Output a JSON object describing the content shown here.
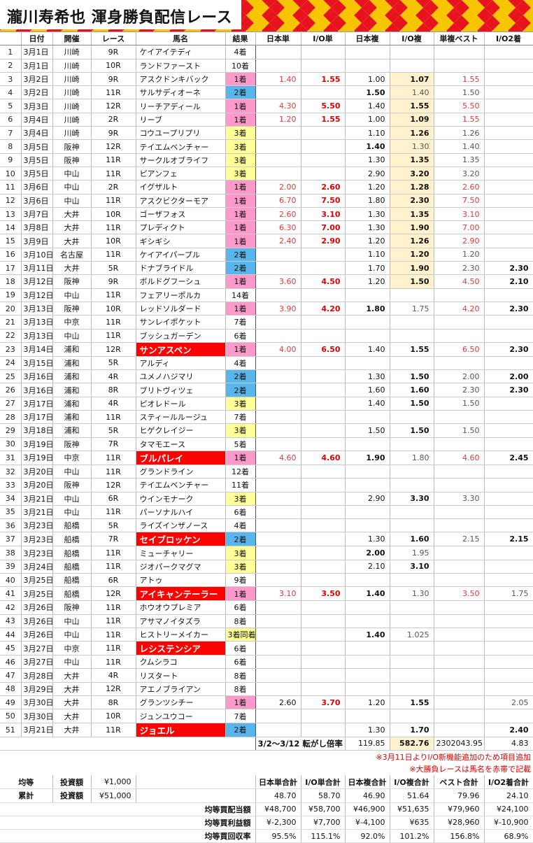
{
  "title": "瀧川寿希也 渾身勝負配信レース",
  "headers": [
    "",
    "日付",
    "開催",
    "レース",
    "馬名",
    "結果",
    "日本単",
    "I/O単",
    "日本複",
    "I/O複",
    "単複ベスト",
    "I/O2着"
  ],
  "rows": [
    [
      "1",
      "3月1日",
      "川崎",
      "9R",
      "ケイアイテディ",
      "4着",
      "",
      "",
      "",
      "",
      "",
      ""
    ],
    [
      "2",
      "3月1日",
      "川崎",
      "10R",
      "ランドファースト",
      "10着",
      "",
      "",
      "",
      "",
      "",
      ""
    ],
    [
      "3",
      "3月2日",
      "川崎",
      "9R",
      "アスクドンキバック",
      "1着",
      "1.40",
      "1.55",
      "1.00",
      "1.07",
      "1.55",
      ""
    ],
    [
      "4",
      "3月2日",
      "川崎",
      "11R",
      "サルサディオーネ",
      "2着",
      "",
      "",
      "1.50",
      "1.40",
      "1.50",
      ""
    ],
    [
      "5",
      "3月3日",
      "川崎",
      "12R",
      "リーチアディール",
      "1着",
      "4.30",
      "5.50",
      "1.40",
      "1.55",
      "5.50",
      ""
    ],
    [
      "6",
      "3月4日",
      "川崎",
      "2R",
      "リーブ",
      "1着",
      "1.20",
      "1.55",
      "1.00",
      "1.09",
      "1.55",
      ""
    ],
    [
      "7",
      "3月4日",
      "川崎",
      "9R",
      "コウユープリプリ",
      "3着",
      "",
      "",
      "1.10",
      "1.26",
      "1.26",
      ""
    ],
    [
      "8",
      "3月5日",
      "阪神",
      "12R",
      "テイエムベンチャー",
      "3着",
      "",
      "",
      "1.40",
      "1.30",
      "1.40",
      ""
    ],
    [
      "9",
      "3月5日",
      "阪神",
      "11R",
      "サークルオブライフ",
      "3着",
      "",
      "",
      "1.30",
      "1.35",
      "1.35",
      ""
    ],
    [
      "10",
      "3月5日",
      "中山",
      "11R",
      "ピアンフェ",
      "3着",
      "",
      "",
      "2.90",
      "3.20",
      "3.20",
      ""
    ],
    [
      "11",
      "3月6日",
      "中山",
      "2R",
      "イグザルト",
      "1着",
      "2.00",
      "2.60",
      "1.20",
      "1.28",
      "2.60",
      ""
    ],
    [
      "12",
      "3月6日",
      "中山",
      "11R",
      "アスクビクターモア",
      "1着",
      "6.70",
      "7.50",
      "1.80",
      "2.30",
      "7.50",
      ""
    ],
    [
      "13",
      "3月7日",
      "大井",
      "10R",
      "ゴーザフォス",
      "1着",
      "2.60",
      "3.10",
      "1.30",
      "1.35",
      "3.10",
      ""
    ],
    [
      "14",
      "3月8日",
      "大井",
      "11R",
      "プレディクト",
      "1着",
      "6.30",
      "7.00",
      "1.30",
      "1.90",
      "7.00",
      ""
    ],
    [
      "15",
      "3月9日",
      "大井",
      "10R",
      "ギシギシ",
      "1着",
      "2.40",
      "2.90",
      "1.20",
      "1.26",
      "2.90",
      ""
    ],
    [
      "16",
      "3月10日",
      "名古屋",
      "11R",
      "ケイアイパープル",
      "2着",
      "",
      "",
      "1.10",
      "1.20",
      "1.20",
      ""
    ],
    [
      "17",
      "3月11日",
      "大井",
      "5R",
      "ドナブライドル",
      "2着",
      "",
      "",
      "1.70",
      "1.90",
      "2.30",
      "2.30"
    ],
    [
      "18",
      "3月12日",
      "阪神",
      "9R",
      "ボルドグフーシュ",
      "1着",
      "3.60",
      "4.50",
      "1.20",
      "1.50",
      "4.50",
      "2.10"
    ],
    [
      "19",
      "3月12日",
      "中山",
      "11R",
      "フェアリーポルカ",
      "14着",
      "",
      "",
      "",
      "",
      "",
      ""
    ],
    [
      "20",
      "3月13日",
      "阪神",
      "10R",
      "レッドソルダード",
      "1着",
      "3.90",
      "4.20",
      "1.80",
      "1.75",
      "4.20",
      "2.30"
    ],
    [
      "21",
      "3月13日",
      "中京",
      "11R",
      "サンレイポケット",
      "7着",
      "",
      "",
      "",
      "",
      "",
      ""
    ],
    [
      "22",
      "3月13日",
      "中山",
      "11R",
      "ブッシュガーデン",
      "6着",
      "",
      "",
      "",
      "",
      "",
      ""
    ],
    [
      "23",
      "3月14日",
      "浦和",
      "12R",
      "サンアスペン",
      "1着",
      "4.00",
      "6.50",
      "1.40",
      "1.55",
      "6.50",
      "2.30"
    ],
    [
      "24",
      "3月15日",
      "浦和",
      "5R",
      "アルディ",
      "4着",
      "",
      "",
      "",
      "",
      "",
      ""
    ],
    [
      "25",
      "3月16日",
      "浦和",
      "4R",
      "ユメノハジマリ",
      "2着",
      "",
      "",
      "1.30",
      "1.50",
      "2.00",
      "2.00"
    ],
    [
      "26",
      "3月16日",
      "浦和",
      "8R",
      "ブリトヴィツェ",
      "2着",
      "",
      "",
      "1.60",
      "1.60",
      "2.30",
      "2.30"
    ],
    [
      "27",
      "3月17日",
      "浦和",
      "4R",
      "ピオレドール",
      "3着",
      "",
      "",
      "1.40",
      "1.50",
      "1.50",
      ""
    ],
    [
      "28",
      "3月17日",
      "浦和",
      "11R",
      "スティールルージュ",
      "7着",
      "",
      "",
      "",
      "",
      "",
      ""
    ],
    [
      "29",
      "3月18日",
      "浦和",
      "5R",
      "ヒゲクレイジー",
      "3着",
      "",
      "",
      "1.50",
      "1.50",
      "1.50",
      ""
    ],
    [
      "30",
      "3月19日",
      "阪神",
      "7R",
      "タマモエース",
      "5着",
      "",
      "",
      "",
      "",
      "",
      ""
    ],
    [
      "31",
      "3月19日",
      "中京",
      "11R",
      "ブルパレイ",
      "1着",
      "4.60",
      "4.60",
      "1.90",
      "1.80",
      "4.60",
      "2.45"
    ],
    [
      "32",
      "3月20日",
      "中山",
      "11R",
      "グランドライン",
      "12着",
      "",
      "",
      "",
      "",
      "",
      ""
    ],
    [
      "33",
      "3月20日",
      "阪神",
      "12R",
      "テイエムベンチャー",
      "11着",
      "",
      "",
      "",
      "",
      "",
      ""
    ],
    [
      "34",
      "3月21日",
      "中山",
      "6R",
      "ウインモナーク",
      "3着",
      "",
      "",
      "2.90",
      "3.30",
      "3.30",
      ""
    ],
    [
      "35",
      "3月21日",
      "中山",
      "11R",
      "パーソナルハイ",
      "6着",
      "",
      "",
      "",
      "",
      "",
      ""
    ],
    [
      "36",
      "3月23日",
      "船橋",
      "5R",
      "ライズインザノース",
      "4着",
      "",
      "",
      "",
      "",
      "",
      ""
    ],
    [
      "37",
      "3月23日",
      "船橋",
      "7R",
      "セイブロッケン",
      "2着",
      "",
      "",
      "1.30",
      "1.60",
      "2.15",
      "2.15"
    ],
    [
      "38",
      "3月23日",
      "船橋",
      "11R",
      "ミューチャリー",
      "3着",
      "",
      "",
      "2.00",
      "1.95",
      "",
      ""
    ],
    [
      "39",
      "3月24日",
      "船橋",
      "11R",
      "ジオパークマグマ",
      "3着",
      "",
      "",
      "2.10",
      "3.10",
      "",
      ""
    ],
    [
      "40",
      "3月25日",
      "船橋",
      "6R",
      "アトゥ",
      "9着",
      "",
      "",
      "",
      "",
      "",
      ""
    ],
    [
      "41",
      "3月25日",
      "船橋",
      "12R",
      "アイキャンテーラー",
      "1着",
      "3.10",
      "3.50",
      "1.40",
      "1.30",
      "3.50",
      "1.75"
    ],
    [
      "42",
      "3月26日",
      "阪神",
      "11R",
      "ホウオウプレミア",
      "6着",
      "",
      "",
      "",
      "",
      "",
      ""
    ],
    [
      "43",
      "3月26日",
      "中山",
      "11R",
      "アサマノイタズラ",
      "8着",
      "",
      "",
      "",
      "",
      "",
      ""
    ],
    [
      "44",
      "3月26日",
      "中山",
      "11R",
      "ヒストリーメイカー",
      "3着同着",
      "",
      "",
      "1.40",
      "1.025",
      "",
      ""
    ],
    [
      "45",
      "3月27日",
      "中京",
      "11R",
      "レシステンシア",
      "6着",
      "",
      "",
      "",
      "",
      "",
      ""
    ],
    [
      "46",
      "3月27日",
      "中山",
      "11R",
      "クムシラコ",
      "6着",
      "",
      "",
      "",
      "",
      "",
      ""
    ],
    [
      "47",
      "3月28日",
      "大井",
      "4R",
      "リスタート",
      "8着",
      "",
      "",
      "",
      "",
      "",
      ""
    ],
    [
      "48",
      "3月29日",
      "大井",
      "12R",
      "アエノブライアン",
      "8着",
      "",
      "",
      "",
      "",
      "",
      ""
    ],
    [
      "49",
      "3月30日",
      "大井",
      "8R",
      "グランツシチー",
      "1着",
      "2.60",
      "3.70",
      "1.20",
      "1.55",
      "",
      "2.05"
    ],
    [
      "50",
      "3月30日",
      "大井",
      "10R",
      "ジュンユウコー",
      "7着",
      "",
      "",
      "",
      "",
      "",
      ""
    ],
    [
      "51",
      "3月21日",
      "大井",
      "11R",
      "ジョエル",
      "2着",
      "",
      "",
      "1.30",
      "1.70",
      "",
      "2.40"
    ]
  ],
  "big_rows": [
    23,
    31,
    37,
    41,
    45,
    51
  ],
  "totals_row": {
    "label": "3/2〜3/12 転がし倍率",
    "values": [
      "119.85",
      "582.76",
      "2302043.95",
      "4.83"
    ]
  },
  "notes": [
    "※3月11日よりI/O新機能追加のため項目追加",
    "※大勝負レースは馬名を赤帯で記載"
  ],
  "summary": {
    "header": [
      "日本単合計",
      "I/O単合計",
      "日本複合計",
      "I/O複合計",
      "ベスト合計",
      "I/O2着合計"
    ],
    "even_label": "均等",
    "total_label": "累計",
    "invest_label": "投資額",
    "even_invest": "¥1,000",
    "total_invest": "¥51,000",
    "sums": [
      "48.70",
      "58.70",
      "46.90",
      "51.64",
      "79.96",
      "24.10"
    ],
    "rows": [
      {
        "label": "均等買配当額",
        "values": [
          "¥48,700",
          "¥58,700",
          "¥46,900",
          "¥51,635",
          "¥79,960",
          "¥24,100"
        ]
      },
      {
        "label": "均等買利益額",
        "values": [
          "¥-2,300",
          "¥7,700",
          "¥-4,100",
          "¥635",
          "¥28,960",
          "¥-10,900"
        ]
      },
      {
        "label": "均等買回収率",
        "values": [
          "95.5%",
          "115.1%",
          "92.0%",
          "101.2%",
          "156.8%",
          "68.9%"
        ]
      }
    ]
  },
  "colors": {
    "pink": "#ff99cc",
    "blue": "#59b6ec",
    "yellow": "#ffff99",
    "red_band": "#ff0000",
    "highlight": "#fff2cc",
    "pattern_red": "#e8141d",
    "pattern_gold": "#f7c500"
  }
}
